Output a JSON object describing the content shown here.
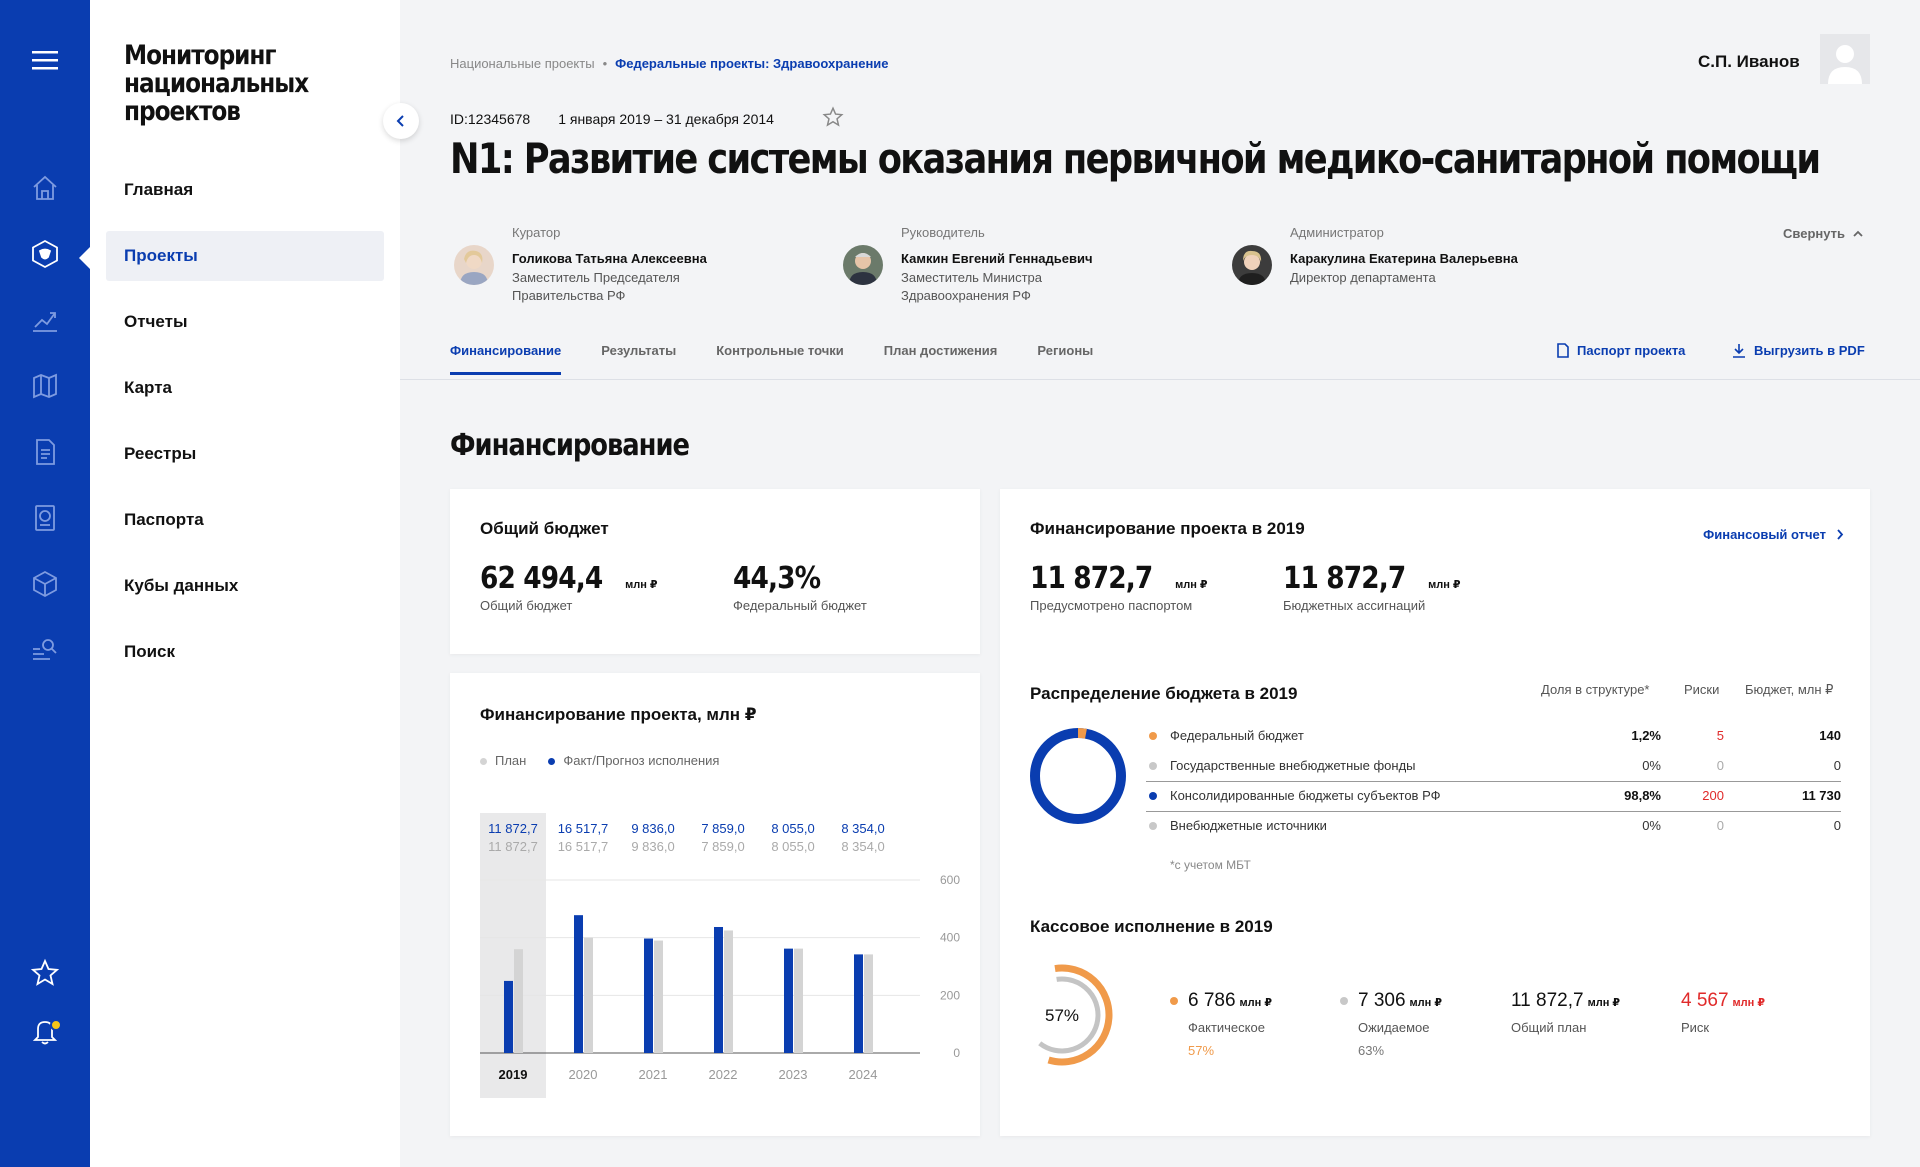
{
  "app": {
    "title_line1": "Мониторинг",
    "title_line2": "национальных",
    "title_line3": "проектов"
  },
  "rail": {
    "icons": [
      "menu-icon",
      "home-icon",
      "emblem-icon",
      "chart-icon",
      "map-icon",
      "document-icon",
      "passport-icon",
      "cube-icon",
      "search-list-icon",
      "star-icon",
      "bell-icon"
    ]
  },
  "menu": {
    "items": [
      {
        "label": "Главная"
      },
      {
        "label": "Проекты"
      },
      {
        "label": "Отчеты"
      },
      {
        "label": "Карта"
      },
      {
        "label": "Реестры"
      },
      {
        "label": "Паспорта"
      },
      {
        "label": "Кубы данных"
      },
      {
        "label": "Поиск"
      }
    ],
    "active": "Проекты"
  },
  "header": {
    "breadcrumb": [
      "Национальные проекты",
      "•",
      "Федеральные проекты: Здравоохранение"
    ],
    "user_name": "С.П. Иванов",
    "id": "ID:12345678",
    "period": "1 января 2019 – 31 декабря 2014",
    "title": "N1: Развитие системы оказания первичной медико-санитарной помощи",
    "collapse_label": "Свернуть",
    "people": [
      {
        "role": "Куратор",
        "name": "Голикова Татьяна Алексеевна",
        "position": "Заместитель Председателя Правительства РФ"
      },
      {
        "role": "Руководитель",
        "name": "Камкин Евгений Геннадьевич",
        "position": "Заместитель Министра Здравоохранения РФ"
      },
      {
        "role": "Администратор",
        "name": "Каракулина Екатерина Валерьевна",
        "position": "Директор департамента"
      }
    ],
    "tabs": [
      "Финансирование",
      "Результаты",
      "Контрольные точки",
      "План достижения",
      "Регионы"
    ],
    "active_tab": "Финансирование",
    "passport_link": "Паспорт проекта",
    "pdf_link": "Выгрузить в PDF"
  },
  "section_title": "Финансирование",
  "budget": {
    "title": "Общий бюджет",
    "total_value": "62 494,4",
    "total_unit": "млн ₽",
    "total_label": "Общий бюджет",
    "federal_value": "44,3%",
    "federal_label": "Федеральный бюджет"
  },
  "financing_chart": {
    "title": "Финансирование проекта, млн ₽",
    "legend_plan": "План",
    "legend_fact": "Факт/Прогноз исполнения"
  },
  "chart_data": {
    "type": "bar",
    "title": "Финансирование проекта, млн ₽",
    "categories": [
      "2019",
      "2020",
      "2021",
      "2022",
      "2023",
      "2024"
    ],
    "selected": "2019",
    "series": [
      {
        "name": "План",
        "values": [
          360,
          400,
          390,
          425,
          362,
          342
        ],
        "color": "#d4d4d4"
      },
      {
        "name": "Факт/Прогноз исполнения",
        "values": [
          250,
          478,
          397,
          437,
          362,
          342
        ],
        "color": "#0a3db0"
      }
    ],
    "top_labels_fact": [
      "11 872,7",
      "16 517,7",
      "9 836,0",
      "7 859,0",
      "8 055,0",
      "8 354,0"
    ],
    "top_labels_plan": [
      "11 872,7",
      "16 517,7",
      "9 836,0",
      "7 859,0",
      "8 055,0",
      "8 354,0"
    ],
    "y_ticks": [
      "600",
      "400",
      "200",
      "0"
    ],
    "ylim": [
      0,
      600
    ],
    "grid": true
  },
  "project_financing": {
    "title": "Финансирование проекта в 2019",
    "report_link": "Финансовый отчет",
    "passport_value": "11 872,7",
    "passport_label": "Предусмотрено паспортом",
    "assign_value": "11 872,7",
    "assign_label": "Бюджетных ассигнаций",
    "unit": "млн ₽"
  },
  "distribution": {
    "title": "Распределение бюджета в 2019",
    "col_share": "Доля в структуре*",
    "col_risk": "Риски",
    "col_budget": "Бюджет, млн ₽",
    "rows": [
      {
        "name": "Федеральный бюджет",
        "share": "1,2%",
        "risk": "5",
        "budget": "140",
        "color": "#f09a4a",
        "risk_color": "#e02a2a"
      },
      {
        "name": "Государственные внебюджетные фонды",
        "share": "0%",
        "risk": "0",
        "budget": "0",
        "color": "#c8c8c8",
        "risk_color": "#aaaaaa"
      },
      {
        "name": "Консолидированные бюджеты субъектов РФ",
        "share": "98,8%",
        "risk": "200",
        "budget": "11 730",
        "color": "#0a3db0",
        "risk_color": "#e02a2a"
      },
      {
        "name": "Внебюджетные источники",
        "share": "0%",
        "risk": "0",
        "budget": "0",
        "color": "#c8c8c8",
        "risk_color": "#aaaaaa"
      }
    ],
    "footnote": "*с учетом МБТ"
  },
  "cash": {
    "title": "Кассовое исполнение в 2019",
    "gauge_label": "57%",
    "gauge_fact_pct": 57,
    "gauge_expected_pct": 63,
    "items": [
      {
        "value": "6 786",
        "unit": "млн ₽",
        "label": "Фактическое",
        "pct": "57%",
        "dot": "#f09a4a",
        "pct_color": "#f09a4a"
      },
      {
        "value": "7 306",
        "unit": "млн ₽",
        "label": "Ожидаемое",
        "pct": "63%",
        "dot": "#c8c8c8",
        "pct_color": "#777777"
      },
      {
        "value": "11 872,7",
        "unit": "млн ₽",
        "label": "Общий план"
      },
      {
        "value": "4 567",
        "unit": "млн ₽",
        "label": "Риск",
        "color": "#e02a2a"
      }
    ]
  },
  "colors": {
    "brand": "#0a3db0",
    "accent": "#f09a4a",
    "risk": "#e02a2a"
  }
}
